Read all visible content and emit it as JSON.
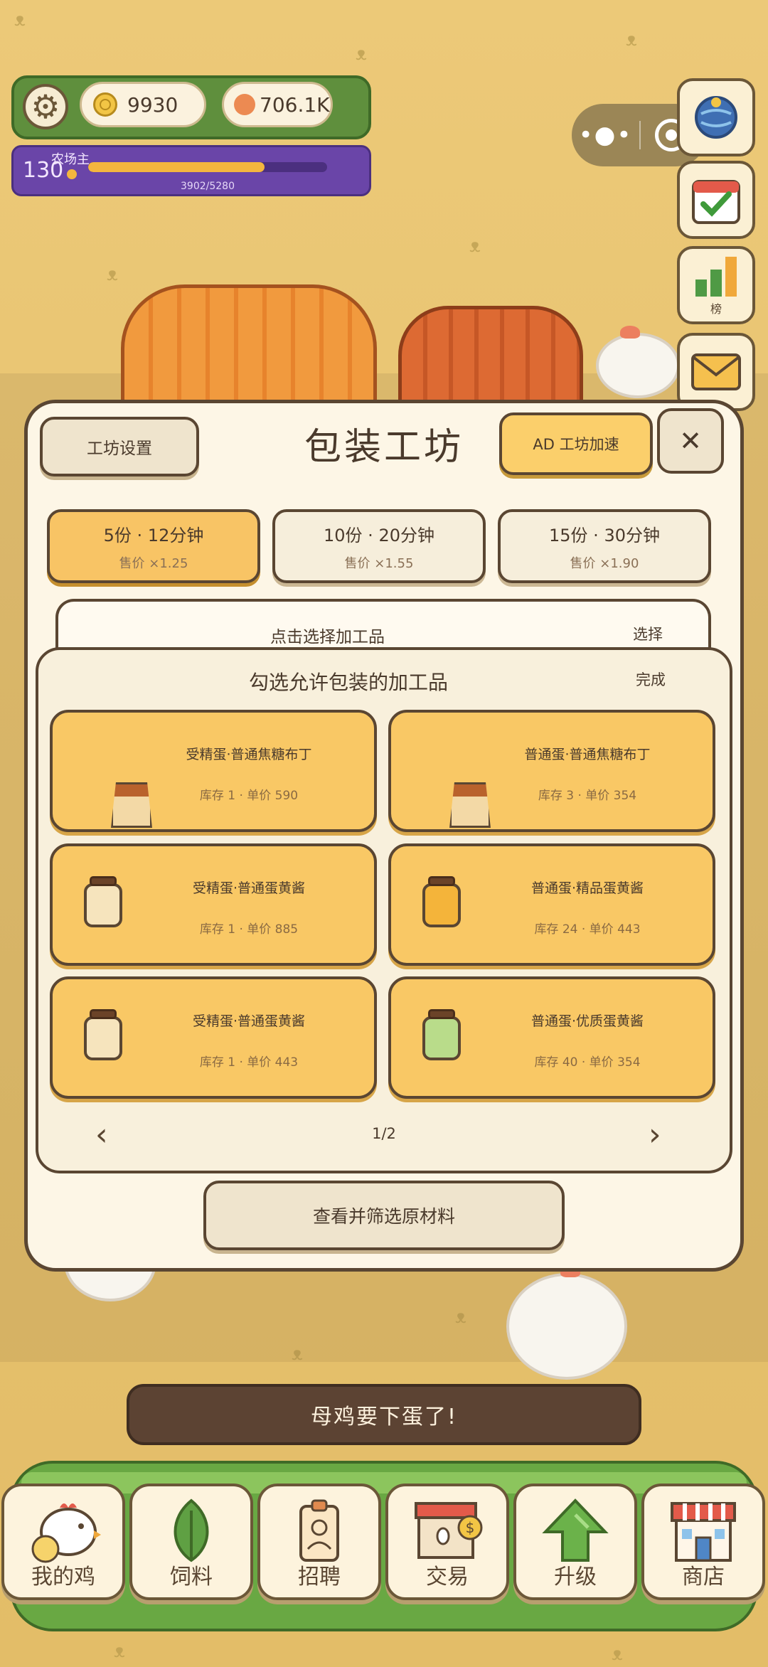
{
  "hud": {
    "coins": "9930",
    "gems": "706.1K",
    "level": "130",
    "level_title": "农场主",
    "xp_text": "3902/5280",
    "xp_progress": 0.739
  },
  "side_buttons": [
    {
      "name": "globe"
    },
    {
      "name": "calendar"
    },
    {
      "name": "leaderboard",
      "label": "榜"
    },
    {
      "name": "mail"
    }
  ],
  "workshop": {
    "settings_label": "工坊设置",
    "title": "包装工坊",
    "boost_label": "AD 工坊加速",
    "close_label": "✕",
    "options": [
      {
        "main": "5份 · 12分钟",
        "sub": "售价 ×1.25",
        "selected": true
      },
      {
        "main": "10份 · 20分钟",
        "sub": "售价 ×1.55",
        "selected": false
      },
      {
        "main": "15份 · 30分钟",
        "sub": "售价 ×1.90",
        "selected": false
      }
    ],
    "select_prompt": "点击选择加工品",
    "select_action": "选择",
    "panel_title": "勾选允许包装的加工品",
    "panel_done": "完成",
    "items": [
      {
        "name": "受精蛋·普通焦糖布丁",
        "info": "库存 1 · 单价 590",
        "icon": "pudding-icon"
      },
      {
        "name": "普通蛋·普通焦糖布丁",
        "info": "库存 3 · 单价 354",
        "icon": "pudding-icon"
      },
      {
        "name": "受精蛋·普通蛋黄酱",
        "info": "库存 1 · 单价 885",
        "icon": "jar-icon",
        "jar_color": "#f6e4bd"
      },
      {
        "name": "普通蛋·精品蛋黄酱",
        "info": "库存 24 · 单价 443",
        "icon": "jar-icon",
        "jar_color": "#f4b43a"
      },
      {
        "name": "受精蛋·普通蛋黄酱",
        "info": "库存 1 · 单价 443",
        "icon": "jar-icon",
        "jar_color": "#f6e4bd"
      },
      {
        "name": "普通蛋·优质蛋黄酱",
        "info": "库存 40 · 单价 354",
        "icon": "jar-icon",
        "jar_color": "#b9dc8a"
      }
    ],
    "pager_prev": "‹",
    "pager_text": "1/2",
    "pager_next": "›",
    "materials_label": "查看并筛选原材料"
  },
  "toast": "母鸡要下蛋了!",
  "nav": [
    {
      "label": "我的鸡",
      "icon": "chicken-icon"
    },
    {
      "label": "饲料",
      "icon": "leaf-icon"
    },
    {
      "label": "招聘",
      "icon": "badge-icon"
    },
    {
      "label": "交易",
      "icon": "market-icon"
    },
    {
      "label": "升级",
      "icon": "arrow-up-icon"
    },
    {
      "label": "商店",
      "icon": "shop-icon"
    }
  ],
  "colors": {
    "accent": "#f8c465",
    "panel": "#fdf6e6",
    "outline": "#5a4632",
    "hud_green": "#5f8f3d",
    "level_purple": "#6a45a8"
  }
}
